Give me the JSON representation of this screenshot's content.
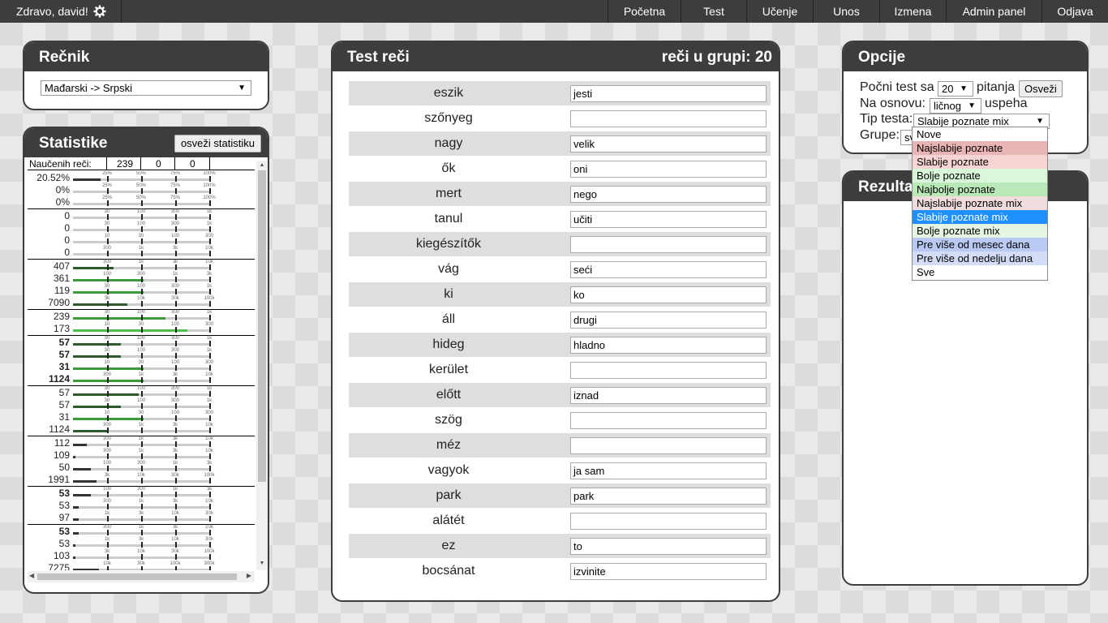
{
  "nav": {
    "greeting": "Zdravo, david!",
    "items": [
      "Početna",
      "Test",
      "Učenje",
      "Unos",
      "Izmena",
      "Admin panel",
      "Odjava"
    ]
  },
  "dictionary": {
    "title": "Rečnik",
    "selected": "Mađarski -> Srpski"
  },
  "stats": {
    "title": "Statistike",
    "refresh_label": "osveži statistiku",
    "header_label": "Naučenih reči:",
    "header_values": [
      "239",
      "0",
      "0"
    ],
    "rows": [
      {
        "v": "20.52%",
        "f": 0.2,
        "c": "#333",
        "t": [
          "25%",
          "50%",
          "75%",
          "100%"
        ]
      },
      {
        "v": "0%",
        "f": 0,
        "c": "#333",
        "t": [
          "25%",
          "50%",
          "75%",
          "100%"
        ]
      },
      {
        "v": "0%",
        "f": 0,
        "c": "#333",
        "t": [
          "25%",
          "50%",
          "75%",
          "100%"
        ]
      },
      {
        "v": "0",
        "f": 0,
        "c": "#333",
        "t": [
          "30",
          "100",
          "300",
          "1k"
        ]
      },
      {
        "v": "0",
        "f": 0,
        "c": "#333",
        "t": [
          "30",
          "100",
          "300",
          "1k"
        ]
      },
      {
        "v": "0",
        "f": 0,
        "c": "#333",
        "t": [
          "10",
          "30",
          "100",
          "300"
        ]
      },
      {
        "v": "0",
        "f": 0,
        "c": "#333",
        "t": [
          "300",
          "1k",
          "3k",
          "10k"
        ]
      },
      {
        "v": "407",
        "f": 0.3,
        "c": "#2d5a2d",
        "t": [
          "300",
          "1k",
          "3k",
          "10k"
        ]
      },
      {
        "v": "361",
        "f": 0.52,
        "c": "#3a9b3a",
        "t": [
          "100",
          "300",
          "1k",
          "3k"
        ]
      },
      {
        "v": "119",
        "f": 0.52,
        "c": "#3a9b3a",
        "t": [
          "30",
          "100",
          "300",
          "1k"
        ]
      },
      {
        "v": "7090",
        "f": 0.4,
        "c": "#2d5a2d",
        "t": [
          "3k",
          "10k",
          "30k",
          "100k"
        ]
      },
      {
        "v": "239",
        "f": 0.68,
        "c": "#3a9b3a",
        "t": [
          "30",
          "100",
          "300",
          "1k"
        ]
      },
      {
        "v": "173",
        "f": 0.84,
        "c": "#4cc04c",
        "t": [
          "10",
          "30",
          "100",
          "300"
        ]
      },
      {
        "v": "57",
        "b": true,
        "f": 0.35,
        "c": "#2d5a2d",
        "t": [
          "30",
          "100",
          "300",
          "1k"
        ]
      },
      {
        "v": "57",
        "b": true,
        "f": 0.35,
        "c": "#2d5a2d",
        "t": [
          "30",
          "100",
          "300",
          "1k"
        ]
      },
      {
        "v": "31",
        "b": true,
        "f": 0.52,
        "c": "#3a9b3a",
        "t": [
          "10",
          "30",
          "100",
          "300"
        ]
      },
      {
        "v": "1124",
        "b": true,
        "f": 0.52,
        "c": "#3a9b3a",
        "t": [
          "300",
          "1k",
          "3k",
          "10k"
        ]
      },
      {
        "v": "57",
        "f": 0.48,
        "c": "#2d5a2d",
        "t": [
          "30",
          "100",
          "300",
          "1k"
        ]
      },
      {
        "v": "57",
        "f": 0.35,
        "c": "#2d5a2d",
        "t": [
          "30",
          "100",
          "300",
          "1k"
        ]
      },
      {
        "v": "31",
        "f": 0.52,
        "c": "#3a9b3a",
        "t": [
          "10",
          "30",
          "100",
          "300"
        ]
      },
      {
        "v": "1124",
        "f": 0.26,
        "c": "#2d5a2d",
        "t": [
          "300",
          "1k",
          "3k",
          "10k"
        ]
      },
      {
        "v": "112",
        "f": 0.1,
        "c": "#333",
        "t": [
          "300",
          "1k",
          "3k",
          "10k"
        ]
      },
      {
        "v": "109",
        "f": 0.02,
        "c": "#333",
        "t": [
          "300",
          "1k",
          "3k",
          "10k"
        ]
      },
      {
        "v": "50",
        "f": 0.13,
        "c": "#333",
        "t": [
          "100",
          "300",
          "1k",
          "3k"
        ]
      },
      {
        "v": "1991",
        "f": 0.17,
        "c": "#333",
        "t": [
          "3k",
          "10k",
          "30k",
          "100k"
        ]
      },
      {
        "v": "53",
        "b": true,
        "f": 0.13,
        "c": "#333",
        "t": [
          "100",
          "300",
          "1k",
          "3k"
        ]
      },
      {
        "v": "53",
        "f": 0.04,
        "c": "#333",
        "t": [
          "300",
          "1k",
          "3k",
          "10k"
        ]
      },
      {
        "v": "97",
        "f": 0.04,
        "c": "#333",
        "t": [
          "1k",
          "3k",
          "10k",
          "30k"
        ]
      },
      {
        "v": "53",
        "b": true,
        "f": 0.04,
        "c": "#333",
        "t": [
          "300",
          "1k",
          "3k",
          "10k"
        ]
      },
      {
        "v": "53",
        "f": 0.02,
        "c": "#333",
        "t": [
          "1k",
          "3k",
          "10k",
          "30k"
        ]
      },
      {
        "v": "103",
        "f": 0.02,
        "c": "#333",
        "t": [
          "3k",
          "10k",
          "30k",
          "100k"
        ]
      },
      {
        "v": "7275",
        "f": 0.19,
        "c": "#333",
        "t": [
          "10k",
          "30k",
          "100k",
          "300k"
        ]
      }
    ]
  },
  "test": {
    "title": "Test reči",
    "group_label": "reči u grupi: 20",
    "words": [
      {
        "w": "eszik",
        "a": "jesti"
      },
      {
        "w": "szőnyeg",
        "a": ""
      },
      {
        "w": "nagy",
        "a": "velik"
      },
      {
        "w": "ők",
        "a": "oni"
      },
      {
        "w": "mert",
        "a": "nego"
      },
      {
        "w": "tanul",
        "a": "učiti"
      },
      {
        "w": "kiegészítők",
        "a": ""
      },
      {
        "w": "vág",
        "a": "seći"
      },
      {
        "w": "ki",
        "a": "ko"
      },
      {
        "w": "áll",
        "a": "drugi"
      },
      {
        "w": "hideg",
        "a": "hladno"
      },
      {
        "w": "kerület",
        "a": ""
      },
      {
        "w": "előtt",
        "a": "iznad"
      },
      {
        "w": "szög",
        "a": ""
      },
      {
        "w": "méz",
        "a": ""
      },
      {
        "w": "vagyok",
        "a": "ja sam"
      },
      {
        "w": "park",
        "a": "park"
      },
      {
        "w": "alátét",
        "a": ""
      },
      {
        "w": "ez",
        "a": "to"
      },
      {
        "w": "bocsánat",
        "a": "izvinite"
      }
    ]
  },
  "options": {
    "title": "Opcije",
    "start_label": "Počni test sa",
    "count_value": "20",
    "questions_label": "pitanja",
    "refresh_label": "Osveži",
    "basis_label": "Na osnovu:",
    "basis_value": "ličnog",
    "success_label": "uspeha",
    "type_label": "Tip testa:",
    "type_value": "Slabije poznate mix",
    "groups_label": "Grupe:",
    "groups_value_partial": "sv",
    "type_options": [
      {
        "label": "Nove",
        "bg": "#ffffff"
      },
      {
        "label": "Najslabije poznate",
        "bg": "#e8b4b4"
      },
      {
        "label": "Slabije poznate",
        "bg": "#f7d4d4"
      },
      {
        "label": "Bolje poznate",
        "bg": "#d9f7d9"
      },
      {
        "label": "Najbolje poznate",
        "bg": "#b9e9b9"
      },
      {
        "label": "Najslabije poznate mix",
        "bg": "#efdcdc"
      },
      {
        "label": "Slabije poznate mix",
        "bg": "#1e90ff",
        "selected": true
      },
      {
        "label": "Bolje poznate mix",
        "bg": "#e4f5e4"
      },
      {
        "label": "Pre više od mesec dana",
        "bg": "#b9c9f2"
      },
      {
        "label": "Pre više od nedelju dana",
        "bg": "#d4ddf7"
      },
      {
        "label": "Sve",
        "bg": "#ffffff"
      }
    ]
  },
  "results": {
    "title_partial": "Rezulta"
  }
}
